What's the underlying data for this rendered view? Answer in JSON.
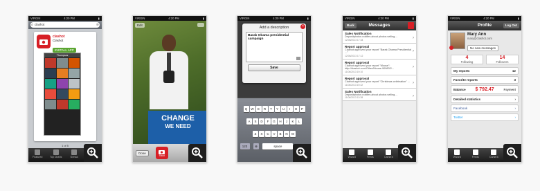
{
  "status": {
    "carrier": "VIRGIN",
    "network": "3G",
    "time": "4:20 PM"
  },
  "shot1": {
    "search_value": "clashot",
    "app_name": "Clashot",
    "app_logo": "clashot",
    "install_label": "INSTALL APP",
    "inner_title": "Thumpsss",
    "page_indicator": "1 of 5",
    "tabs": [
      "Featured",
      "Top Charts",
      "Genius",
      "Search",
      "Updates"
    ]
  },
  "shot2": {
    "edit_label": "Edit",
    "poster_line1": "CHANGE",
    "poster_line2": "WE NEED",
    "done_label": "Done",
    "shoot_label": "Shoot"
  },
  "shot3": {
    "dialog_title": "Add a description",
    "description_text": "Barak Obama presidential campaign",
    "save_label": "Save",
    "keyboard_row1": [
      "Q",
      "W",
      "E",
      "R",
      "T",
      "Y",
      "U",
      "I",
      "O",
      "P"
    ],
    "keyboard_row2": [
      "A",
      "S",
      "D",
      "F",
      "G",
      "H",
      "J",
      "K",
      "L"
    ],
    "keyboard_row3": [
      "Z",
      "X",
      "C",
      "V",
      "B",
      "N",
      "M"
    ],
    "num_key": "123",
    "space_label": "space"
  },
  "shot4": {
    "title": "Messages",
    "back_label": "Back",
    "messages": [
      {
        "title": "Sales Notification",
        "body": "Depositphotos notifies about photos selling ...",
        "date": "12/06/2013 17:34"
      },
      {
        "title": "Report approval",
        "body": "Clashot approved your report \"Barak Obama Presidential ...\"",
        "date": "12/06/2013 17:12"
      },
      {
        "title": "Report approval",
        "body": "Clashot approved your report \"Mouse\": http://clashot.com/Other/Mouse-909832/...",
        "date": "11/06/2013 19:10"
      },
      {
        "title": "Report approval",
        "body": "Clashot approved your report \"Christmas celebration\" ...",
        "date": "11/06/2013 19:42"
      },
      {
        "title": "Sales Notification",
        "body": "Depositphotos notifies about photos selling ...",
        "date": "11/06/2013 13:38"
      }
    ],
    "tabs": [
      "Wizard",
      "Feeds",
      "Camera",
      "Profile",
      "More"
    ]
  },
  "shot5": {
    "title": "Profile",
    "logout_label": "Log Out",
    "user_name": "Mary Ann",
    "user_email": "mary@clashot.com",
    "new_messages_label": "No new messages",
    "following_count": "4",
    "following_label": "Following",
    "followers_count": "14",
    "followers_label": "Followers",
    "my_reports_label": "My reports",
    "my_reports_count": "12",
    "favorite_reports_label": "Favorite reports",
    "favorite_reports_count": "3",
    "balance_label": "Balance",
    "balance_value": "$ 792.47",
    "payment_label": "Payment",
    "detailed_stats_label": "Detailed statistics",
    "facebook_label": "Facebook",
    "twitter_label": "Twitter",
    "tabs": [
      "Wizard",
      "Feeds",
      "Camera",
      "Profile",
      "More"
    ]
  },
  "colors": {
    "accent_red": "#d71f26",
    "install_green": "#5aa530",
    "zoom_bg": "#1e1e1e"
  },
  "icons": {
    "zoom": "magnifier-plus-icon"
  }
}
